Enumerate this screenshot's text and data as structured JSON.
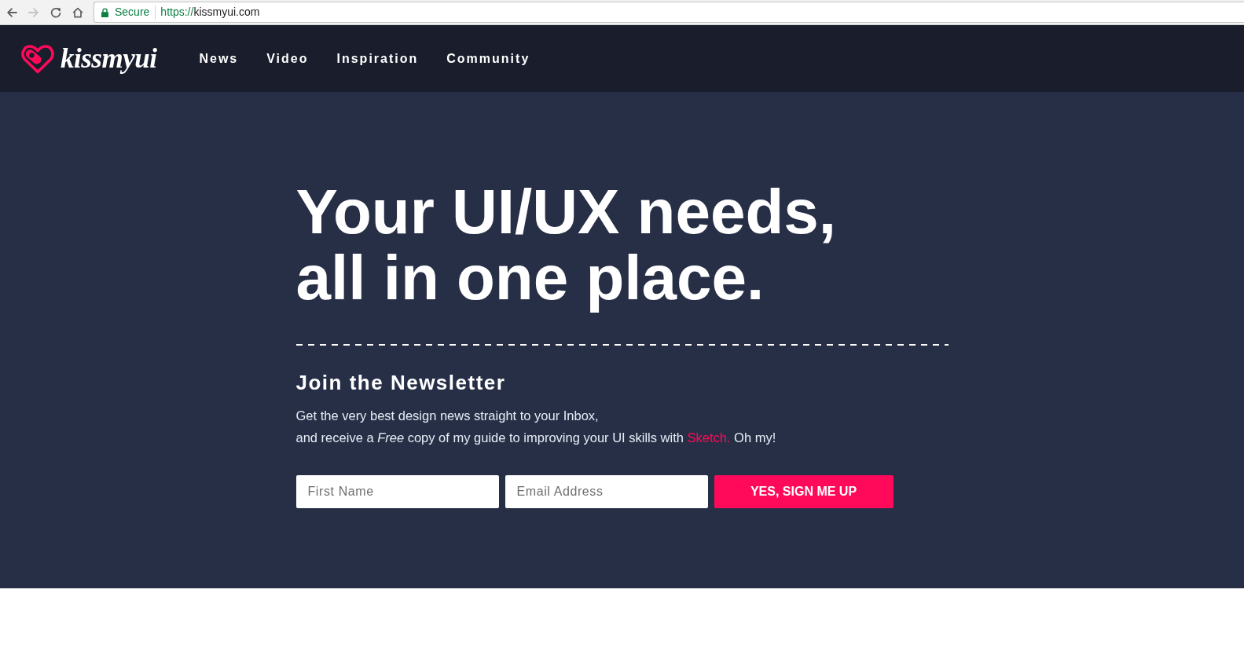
{
  "browser": {
    "nav_buttons": [
      {
        "kind": "back",
        "disabled": false
      },
      {
        "kind": "forward",
        "disabled": true
      },
      {
        "kind": "reload",
        "disabled": false
      },
      {
        "kind": "home",
        "disabled": false
      }
    ],
    "address_bar": {
      "security_label": "Secure",
      "url_scheme": "https://",
      "url_host": "kissmyui.com"
    }
  },
  "site_header": {
    "logo_text": "kissmyui",
    "nav_items": [
      {
        "label": "News"
      },
      {
        "label": "Video"
      },
      {
        "label": "Inspiration"
      },
      {
        "label": "Community"
      }
    ]
  },
  "hero": {
    "headline": [
      "Your UI/UX needs,",
      "all in one place."
    ],
    "newsletter": {
      "title": "Join the Newsletter",
      "description": [
        [
          {
            "kind": "text",
            "text": "Get the very best design news straight to your Inbox,"
          }
        ],
        [
          {
            "kind": "text",
            "text": "and receive a *Free* copy of my guide to improving your UI skills with "
          },
          {
            "kind": "link",
            "text": "Sketch."
          },
          {
            "kind": "text",
            "text": " Oh my!"
          }
        ]
      ],
      "fields": [
        {
          "placeholder": "First Name"
        },
        {
          "placeholder": "Email Address"
        }
      ],
      "submit_label": "YES, SIGN ME UP"
    }
  }
}
